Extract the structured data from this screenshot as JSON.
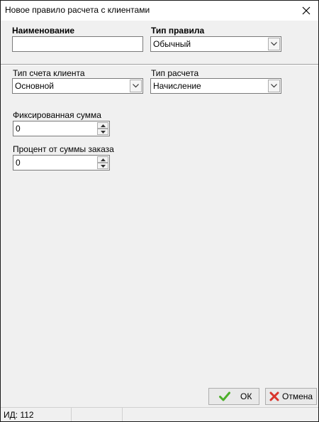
{
  "window": {
    "title": "Новое правило расчета с клиентами"
  },
  "form": {
    "name_label": "Наименование",
    "name_value": "",
    "rule_type_label": "Тип правила",
    "rule_type_value": "Обычный",
    "account_type_label": "Тип счета клиента",
    "account_type_value": "Основной",
    "calc_type_label": "Тип расчета",
    "calc_type_value": "Начисление",
    "fixed_sum_label": "Фиксированная сумма",
    "fixed_sum_value": "0",
    "order_percent_label": "Процент от суммы заказа",
    "order_percent_value": "0"
  },
  "buttons": {
    "ok_label": "ОК",
    "cancel_label": "Отмена"
  },
  "status": {
    "id_text": "ИД: 112"
  },
  "colors": {
    "ok_icon": "#4caf2a",
    "cancel_icon": "#d9342b"
  }
}
